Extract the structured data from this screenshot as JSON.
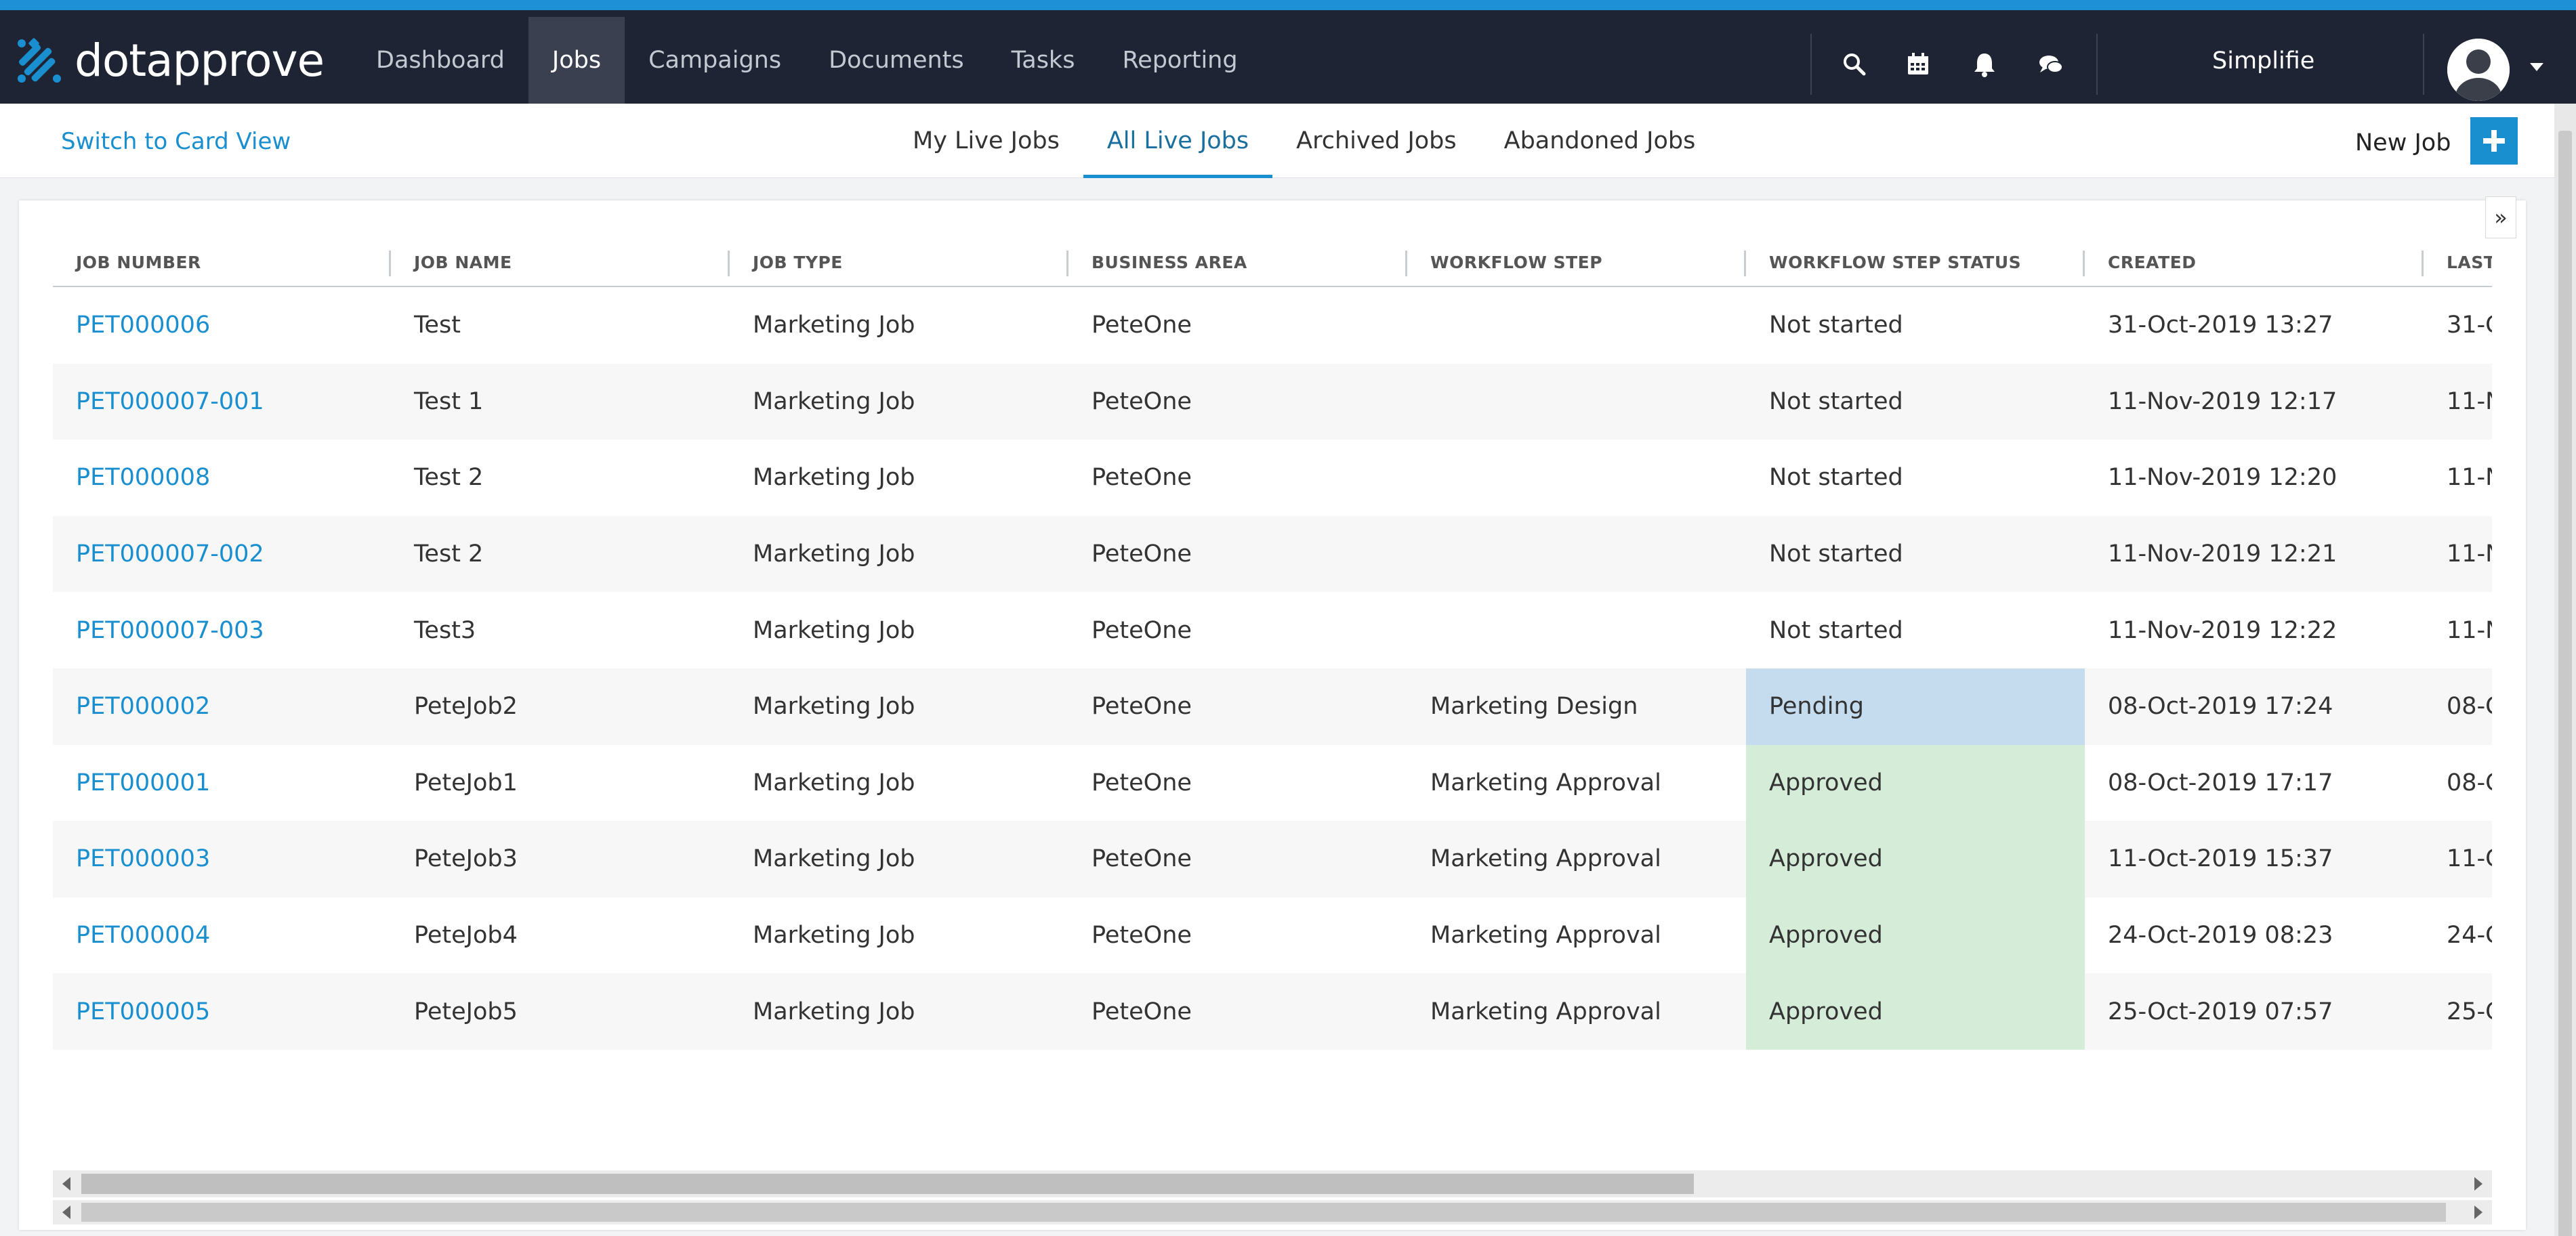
{
  "brand": {
    "name": "dotapprove",
    "primary_color": "#1a8fd0",
    "navbar_color": "#1e2433"
  },
  "nav": {
    "items": [
      {
        "label": "Dashboard",
        "active": false
      },
      {
        "label": "Jobs",
        "active": true
      },
      {
        "label": "Campaigns",
        "active": false
      },
      {
        "label": "Documents",
        "active": false
      },
      {
        "label": "Tasks",
        "active": false
      },
      {
        "label": "Reporting",
        "active": false
      }
    ],
    "icons": [
      "search-icon",
      "calendar-icon",
      "bell-icon",
      "chat-icon"
    ],
    "org_name": "Simplifie"
  },
  "subbar": {
    "switch_view": "Switch to Card View",
    "tabs": [
      {
        "label": "My Live Jobs",
        "active": false
      },
      {
        "label": "All Live Jobs",
        "active": true
      },
      {
        "label": "Archived Jobs",
        "active": false
      },
      {
        "label": "Abandoned Jobs",
        "active": false
      }
    ],
    "new_job": "New Job"
  },
  "grid": {
    "columns": [
      "JOB NUMBER",
      "JOB NAME",
      "JOB TYPE",
      "BUSINESS AREA",
      "WORKFLOW STEP",
      "WORKFLOW STEP STATUS",
      "CREATED",
      "LAST"
    ],
    "rows": [
      {
        "job_number": "PET000006",
        "job_name": "Test",
        "job_type": "Marketing Job",
        "business_area": "PeteOne",
        "workflow_step": "",
        "status": "Not started",
        "status_kind": "none",
        "created": "31-Oct-2019 13:27",
        "last": "31-C"
      },
      {
        "job_number": "PET000007-001",
        "job_name": "Test 1",
        "job_type": "Marketing Job",
        "business_area": "PeteOne",
        "workflow_step": "",
        "status": "Not started",
        "status_kind": "none",
        "created": "11-Nov-2019 12:17",
        "last": "11-N"
      },
      {
        "job_number": "PET000008",
        "job_name": "Test 2",
        "job_type": "Marketing Job",
        "business_area": "PeteOne",
        "workflow_step": "",
        "status": "Not started",
        "status_kind": "none",
        "created": "11-Nov-2019 12:20",
        "last": "11-N"
      },
      {
        "job_number": "PET000007-002",
        "job_name": "Test 2",
        "job_type": "Marketing Job",
        "business_area": "PeteOne",
        "workflow_step": "",
        "status": "Not started",
        "status_kind": "none",
        "created": "11-Nov-2019 12:21",
        "last": "11-N"
      },
      {
        "job_number": "PET000007-003",
        "job_name": "Test3",
        "job_type": "Marketing Job",
        "business_area": "PeteOne",
        "workflow_step": "",
        "status": "Not started",
        "status_kind": "none",
        "created": "11-Nov-2019 12:22",
        "last": "11-N"
      },
      {
        "job_number": "PET000002",
        "job_name": "PeteJob2",
        "job_type": "Marketing Job",
        "business_area": "PeteOne",
        "workflow_step": "Marketing Design",
        "status": "Pending",
        "status_kind": "pending",
        "created": "08-Oct-2019 17:24",
        "last": "08-C"
      },
      {
        "job_number": "PET000001",
        "job_name": "PeteJob1",
        "job_type": "Marketing Job",
        "business_area": "PeteOne",
        "workflow_step": "Marketing Approval",
        "status": "Approved",
        "status_kind": "approved",
        "created": "08-Oct-2019 17:17",
        "last": "08-C"
      },
      {
        "job_number": "PET000003",
        "job_name": "PeteJob3",
        "job_type": "Marketing Job",
        "business_area": "PeteOne",
        "workflow_step": "Marketing Approval",
        "status": "Approved",
        "status_kind": "approved",
        "created": "11-Oct-2019 15:37",
        "last": "11-C"
      },
      {
        "job_number": "PET000004",
        "job_name": "PeteJob4",
        "job_type": "Marketing Job",
        "business_area": "PeteOne",
        "workflow_step": "Marketing Approval",
        "status": "Approved",
        "status_kind": "approved",
        "created": "24-Oct-2019 08:23",
        "last": "24-C"
      },
      {
        "job_number": "PET000005",
        "job_name": "PeteJob5",
        "job_type": "Marketing Job",
        "business_area": "PeteOne",
        "workflow_step": "Marketing Approval",
        "status": "Approved",
        "status_kind": "approved",
        "created": "25-Oct-2019 07:57",
        "last": "25-C"
      }
    ],
    "status_colors": {
      "pending": "#c5dcef",
      "approved": "#d4ecd8"
    }
  }
}
